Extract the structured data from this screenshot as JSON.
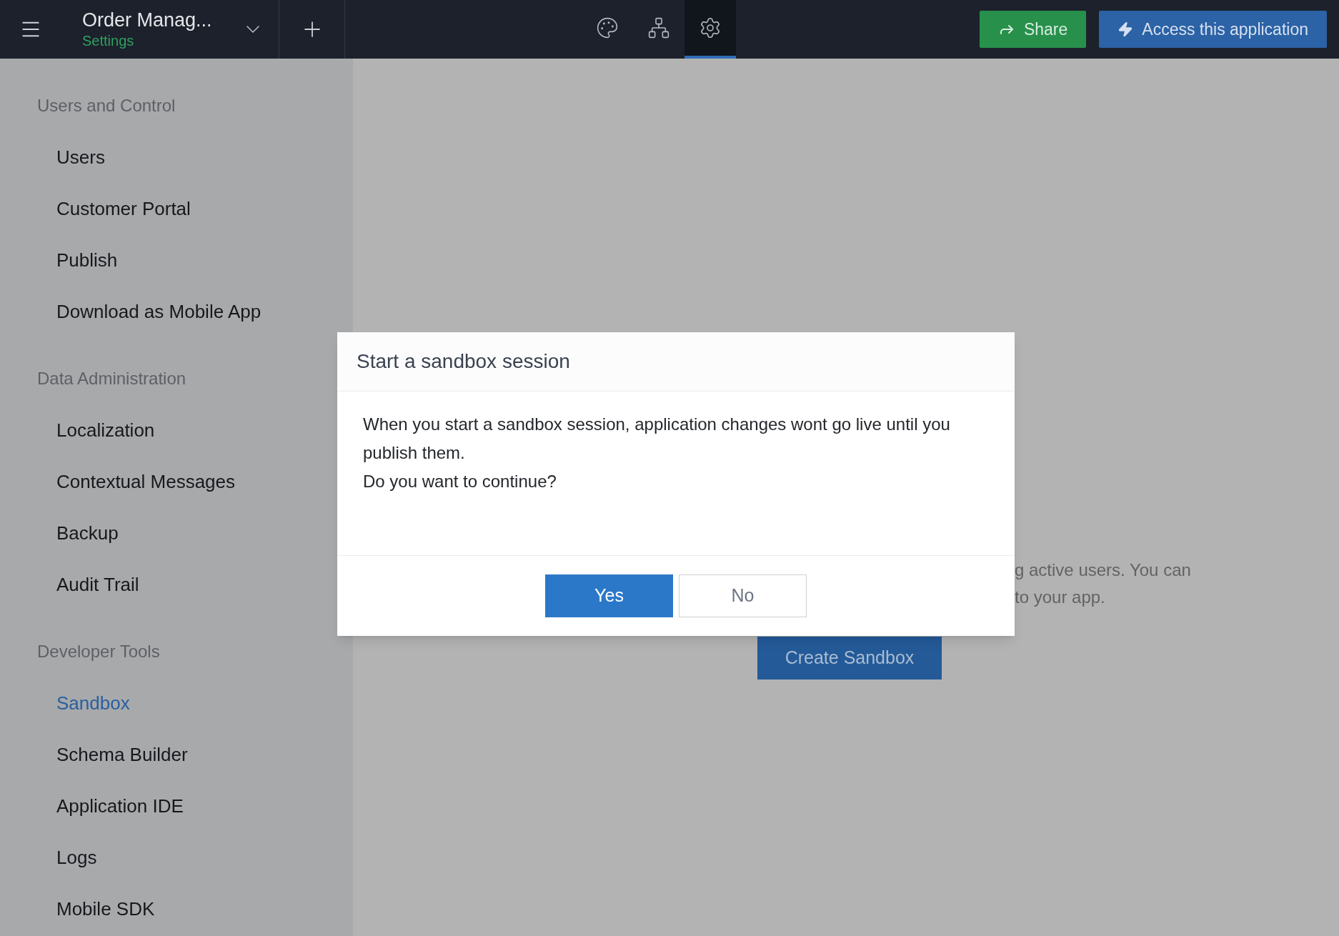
{
  "header": {
    "app_title": "Order Manag...",
    "subtitle": "Settings",
    "tabs": [
      {
        "selected": false
      },
      {
        "selected": false
      },
      {
        "selected": true
      }
    ],
    "buttons": [
      {
        "kind": "share",
        "label": "Share"
      },
      {
        "kind": "access",
        "label": "Access this application"
      }
    ]
  },
  "sidebar": {
    "sections": [
      {
        "title": "Users and Control",
        "items": [
          {
            "label": "Users",
            "selected": false
          },
          {
            "label": "Customer Portal",
            "selected": false
          },
          {
            "label": "Publish",
            "selected": false
          },
          {
            "label": "Download as Mobile App",
            "selected": false
          }
        ]
      },
      {
        "title": "Data Administration",
        "items": [
          {
            "label": "Localization",
            "selected": false
          },
          {
            "label": "Contextual Messages",
            "selected": false
          },
          {
            "label": "Backup",
            "selected": false
          },
          {
            "label": "Audit Trail",
            "selected": false
          }
        ]
      },
      {
        "title": "Developer Tools",
        "items": [
          {
            "label": "Sandbox",
            "selected": true
          },
          {
            "label": "Schema Builder",
            "selected": false
          },
          {
            "label": "Application IDE",
            "selected": false
          },
          {
            "label": "Logs",
            "selected": false
          },
          {
            "label": "Mobile SDK",
            "selected": false
          }
        ]
      }
    ]
  },
  "main": {
    "description_lines": [
      "g active users. You can",
      "to your app."
    ],
    "create_button": "Create Sandbox"
  },
  "dialog": {
    "title": "Start a sandbox session",
    "message": "When you start a sandbox session, application changes wont go live until you publish them.",
    "question": "Do you want to continue?",
    "buttons": [
      {
        "kind": "primary",
        "label": "Yes"
      },
      {
        "kind": "secondary",
        "label": "No"
      }
    ]
  }
}
